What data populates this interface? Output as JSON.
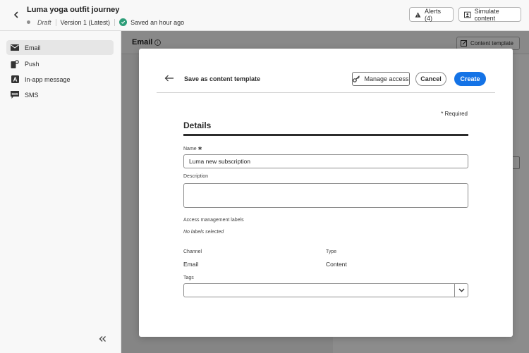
{
  "header": {
    "title": "Luma yoga outfit journey",
    "status": "Draft",
    "version": "Version 1 (Latest)",
    "saved": "Saved an hour ago",
    "alerts_label": "Alerts (4)",
    "simulate_label": "Simulate content"
  },
  "sidebar": {
    "items": [
      {
        "label": "Email",
        "icon": "mail-icon"
      },
      {
        "label": "Push",
        "icon": "push-icon"
      },
      {
        "label": "In-app message",
        "icon": "in-app-icon"
      },
      {
        "label": "SMS",
        "icon": "sms-icon"
      }
    ]
  },
  "main": {
    "title": "Email",
    "content_template_label": "Content template"
  },
  "modal": {
    "title": "Save as content template",
    "manage_access_label": "Manage access",
    "cancel_label": "Cancel",
    "create_label": "Create",
    "required_note": "* Required",
    "section_title": "Details",
    "name_label": "Name",
    "name_value": "Luma new subscription",
    "description_label": "Description",
    "description_value": "",
    "access_labels_label": "Access management labels",
    "access_labels_value": "No labels selected",
    "channel_label": "Channel",
    "channel_value": "Email",
    "type_label": "Type",
    "type_value": "Content",
    "tags_label": "Tags",
    "tags_value": ""
  },
  "colors": {
    "accent": "#1473e6",
    "success": "#2d9d78"
  }
}
